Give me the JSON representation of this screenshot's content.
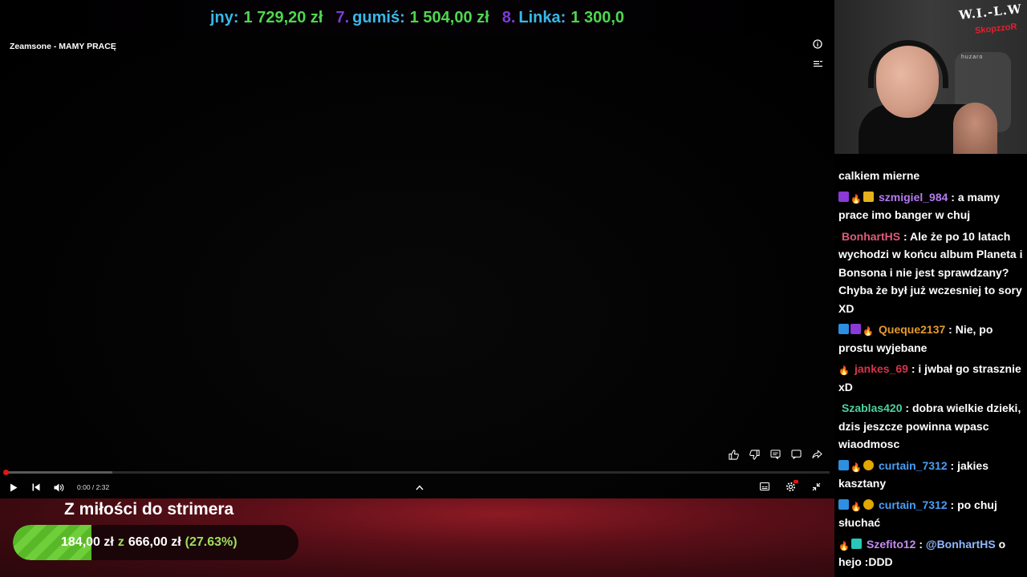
{
  "ticker": {
    "entries": [
      {
        "rank": "",
        "name": "jny",
        "amount": "1 729,20 zł"
      },
      {
        "rank": "7.",
        "name": "gumiś",
        "amount": "1 504,00 zł"
      },
      {
        "rank": "8.",
        "name": "Linka",
        "amount": "1 300,0"
      }
    ]
  },
  "player": {
    "title": "Zeamsone - MAMY PRACĘ",
    "time": "0:00 / 2:32",
    "progress_fraction": 0.0,
    "buffered_fraction": 0.13,
    "icons": {
      "info": "info-icon",
      "playlist": "playlist-icon",
      "like": "thumbs-up-icon",
      "dislike": "thumbs-down-icon",
      "comments": "comment-icon",
      "chat": "chat-bubble-icon",
      "share": "share-icon",
      "play": "play-icon",
      "previous": "skip-previous-icon",
      "volume": "volume-icon",
      "expand": "chevron-up-icon",
      "subtitles": "subtitles-icon",
      "settings": "settings-icon",
      "exit_fullscreen": "exit-fullscreen-icon"
    }
  },
  "goal": {
    "title": "Z miłości do strimera",
    "current": "184,00 zł",
    "separator": "z",
    "target": "666,00 zł",
    "percent_label": "(27.63%)",
    "fraction": 0.2763,
    "color": "#6fcf3a"
  },
  "webcam": {
    "sign": "W.I.-L.W",
    "tag": "SkopzzoR",
    "chair_label": "huzaro"
  },
  "chat": {
    "messages": [
      {
        "badges": [],
        "user": "",
        "color": "#ffffff",
        "text": "calkiem mierne"
      },
      {
        "badges": [
          "purple",
          "fire",
          "crown"
        ],
        "user": "szmigiel_984",
        "color": "#b57bf2",
        "text": "a mamy prace imo banger w chuj"
      },
      {
        "badges": [],
        "user": "BonhartHS",
        "color": "#e05a7a",
        "text": "Ale że po 10 latach wychodzi w końcu album Planeta i Bonsona i nie jest sprawdzany? Chyba że był już wczesniej to sory XD"
      },
      {
        "badges": [
          "blue",
          "purple",
          "fire"
        ],
        "user": "Queque2137",
        "color": "#e39a2d",
        "text": "Nie, po prostu wyjebane"
      },
      {
        "badges": [
          "fire"
        ],
        "user": "jankes_69",
        "color": "#d6344a",
        "text": "i jwbał go strasznie xD"
      },
      {
        "badges": [],
        "user": "Szablas420",
        "color": "#4fd3a1",
        "text": "dobra wielkie dzieki, dzis jeszcze powinna wpasc wiaodmosc"
      },
      {
        "badges": [
          "blue",
          "fire",
          "gold"
        ],
        "user": "curtain_7312",
        "color": "#4a9ef5",
        "text": "jakies kasztany"
      },
      {
        "badges": [
          "blue",
          "fire",
          "gold"
        ],
        "user": "curtain_7312",
        "color": "#4a9ef5",
        "text": "po chuj słuchać"
      },
      {
        "badges": [
          "fire",
          "teal"
        ],
        "user": "Szefito12",
        "color": "#c58bf5",
        "mention": "@BonhartHS",
        "text": "o hejo :DDD"
      }
    ]
  }
}
